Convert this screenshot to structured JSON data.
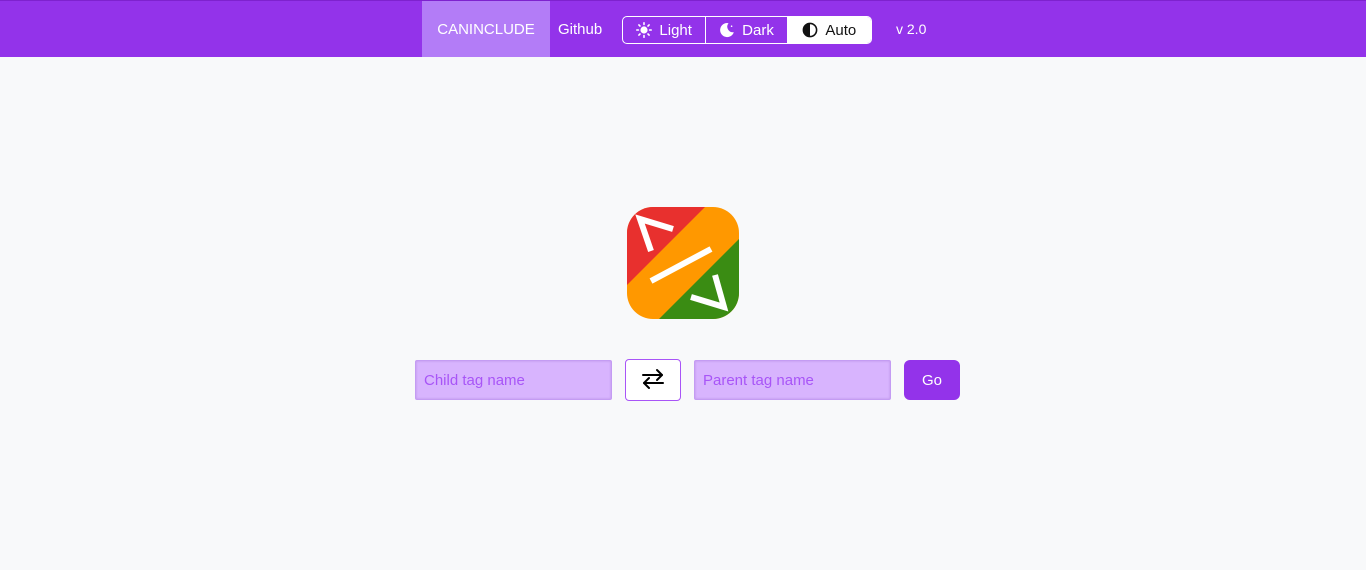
{
  "navbar": {
    "brand": "CANINCLUDE",
    "github_link": "Github",
    "theme_options": [
      {
        "label": "Light",
        "icon": "sun-icon",
        "selected": false
      },
      {
        "label": "Dark",
        "icon": "moon-icon",
        "selected": false
      },
      {
        "label": "Auto",
        "icon": "half-circle-icon",
        "selected": true
      }
    ],
    "version": "v 2.0"
  },
  "logo": {
    "icon": "code-tag-logo",
    "colors": [
      "#e8302e",
      "#ff9800",
      "#3a8c13"
    ]
  },
  "search": {
    "child_placeholder": "Child tag name",
    "child_value": "",
    "swap_icon": "swap-arrows-icon",
    "parent_placeholder": "Parent tag name",
    "parent_value": "",
    "go_label": "Go"
  },
  "colors": {
    "accent": "#9333ea",
    "brand_bg": "#b37cf7",
    "input_bg": "#d8b4fe",
    "page_bg": "#f8f9fa"
  }
}
